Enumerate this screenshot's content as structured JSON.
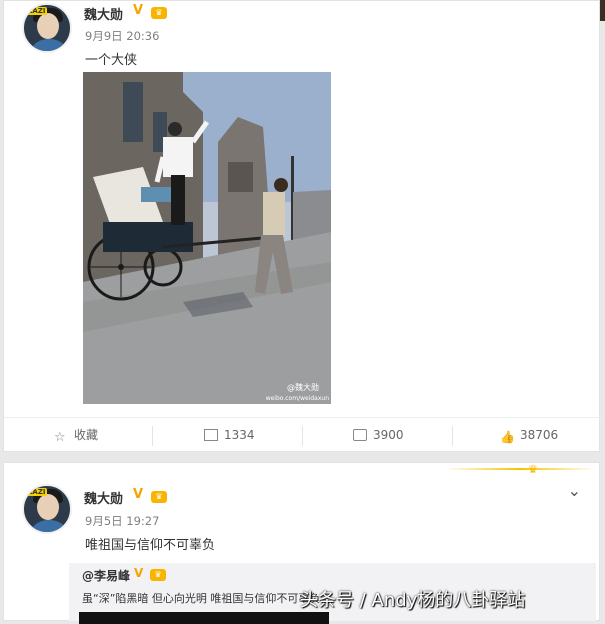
{
  "post1": {
    "author": "魏大勋",
    "time": "9月9日 20:36",
    "text": "一个大侠",
    "photo_watermark_line1": "@魏大勋",
    "photo_watermark_line2": "weibo.com/weidaxun",
    "actions": {
      "favorite": "收藏",
      "repost": "1334",
      "comment": "3900",
      "like": "38706"
    }
  },
  "post2": {
    "author": "魏大勋",
    "time": "9月5日 19:27",
    "text": "唯祖国与信仰不可辜负",
    "quote_author": "@李易峰",
    "quote_text": "虽“深”陷黑暗 但心向光明 唯祖国与信仰不可辜负"
  },
  "avatar_badge": "KAZI",
  "overlay_watermark": "头条号 / Andy杨的八卦驿站",
  "colors": {
    "verified": "#f5a500",
    "muted": "#808080"
  }
}
